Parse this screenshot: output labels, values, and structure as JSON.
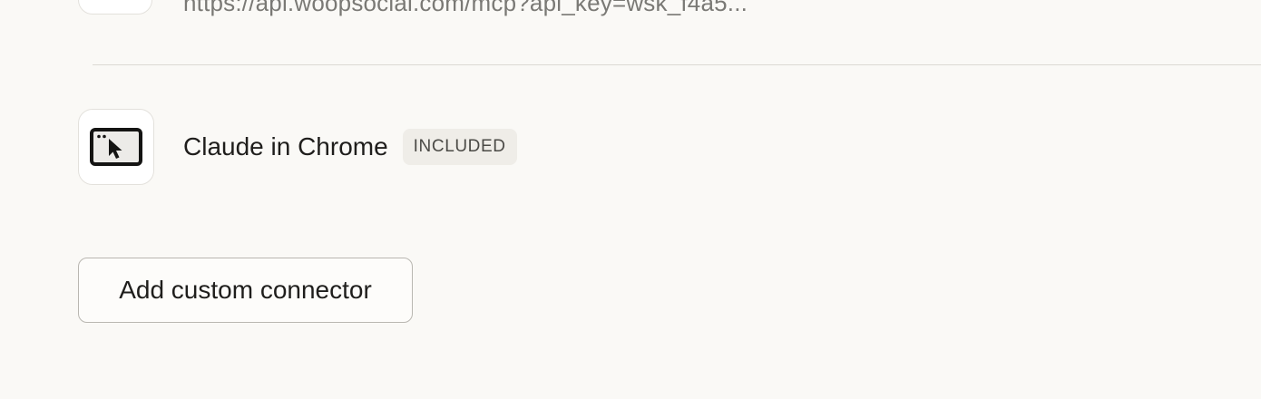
{
  "previous_connector": {
    "url": "https://api.woopsocial.com/mcp?api_key=wsk_f4a5..."
  },
  "connectors": [
    {
      "name": "Claude in Chrome",
      "badge": "INCLUDED",
      "icon": "browser-cursor-icon"
    }
  ],
  "actions": {
    "add_custom_connector_label": "Add custom connector"
  }
}
